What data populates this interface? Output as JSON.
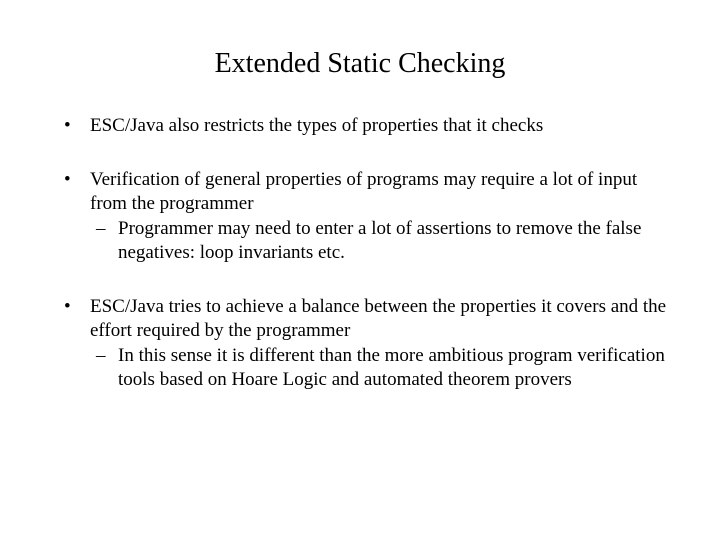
{
  "title": "Extended Static Checking",
  "bullets": [
    {
      "text": "ESC/Java also restricts the types of properties that it checks",
      "sub": []
    },
    {
      "text": "Verification of general properties of programs may require a lot of input from the programmer",
      "sub": [
        "Programmer may need to enter a lot of assertions to remove the false negatives: loop invariants etc."
      ]
    },
    {
      "text": "ESC/Java tries to achieve a balance between the properties it covers and the effort required by the programmer",
      "sub": [
        "In this sense it is different than the more ambitious program verification tools based on Hoare Logic and automated theorem provers"
      ]
    }
  ]
}
